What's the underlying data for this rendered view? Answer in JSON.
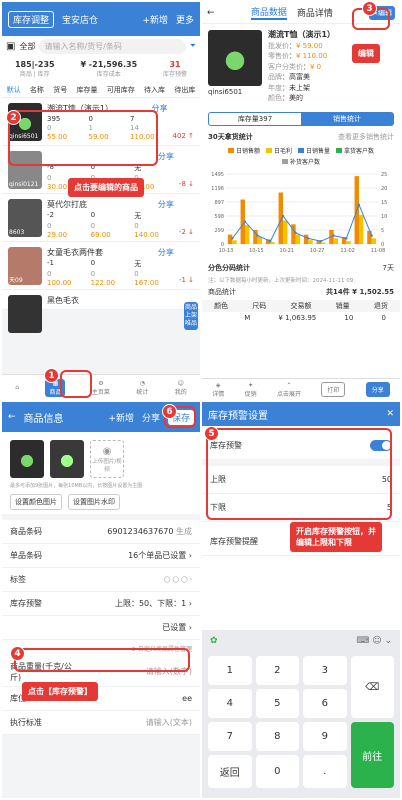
{
  "p1": {
    "header": {
      "title": "库存调整",
      "store": "宝安店仓",
      "new": "+新增",
      "more": "更多"
    },
    "search": {
      "scan": "扫一扫",
      "cat": "全部",
      "placeholder": "请输入名称/货号/条码",
      "filter": "筛选"
    },
    "stats": [
      {
        "v": "185|-235",
        "l": "商品 | 库存"
      },
      {
        "v": "¥ -21,596.35",
        "l": "库存成本"
      },
      {
        "v": "31",
        "l": "库存预警"
      }
    ],
    "cols": [
      "默认",
      "名称",
      "货号",
      "库存量",
      "可用库存",
      "待入库",
      "待出库"
    ],
    "items": [
      {
        "name": "潮流T恤（演示1）",
        "code": "qinsi6501",
        "n": [
          "395",
          "0",
          "7"
        ],
        "n2": [
          "0",
          "1",
          "14"
        ],
        "p": [
          "55.00",
          "59.00",
          "110.00"
        ],
        "trend": "402 ↑",
        "share": "分享"
      },
      {
        "name": "",
        "code": "qinsi0121",
        "n": [
          "-8",
          "0",
          "无"
        ],
        "n2": [
          "0",
          "0",
          "0"
        ],
        "p": [
          "30.00",
          "40.00",
          "69.00"
        ],
        "trend": "-8 ↓",
        "share": "分享"
      },
      {
        "name": "莫代尔打底",
        "code": "8603",
        "n": [
          "-2",
          "0",
          "无"
        ],
        "n2": [
          "0",
          "0",
          "0"
        ],
        "p": [
          "29.00",
          "69.00",
          "140.00"
        ],
        "trend": "-2 ↓",
        "share": "分享"
      },
      {
        "name": "女童毛衣两件套",
        "code": "天09",
        "n": [
          "-1",
          "0",
          "无"
        ],
        "n2": [
          "0",
          "0",
          "0"
        ],
        "p": [
          "100.00",
          "122.00",
          "167.00"
        ],
        "trend": "-1 ↓",
        "share": "分享"
      },
      {
        "name": "黑色毛衣",
        "code": "",
        "n": [],
        "n2": [],
        "p": [],
        "trend": "",
        "share": ""
      }
    ],
    "side": "商品",
    "side2": "上架",
    "side3": "唯品",
    "tabs": [
      "",
      "商品",
      "主页菜",
      "统计",
      "我的"
    ],
    "callout": "点击要编辑的商品"
  },
  "p2": {
    "tabs": [
      "商品数据",
      "商品详情"
    ],
    "edit": "编辑",
    "name": "潮流T恤（演示1）",
    "code": "qinsi6501",
    "info": [
      {
        "k": "批发价",
        "v": "¥ 59.00"
      },
      {
        "k": "零售价",
        "v": "¥ 110.00"
      },
      {
        "k": "客户分类价",
        "v": "¥ 0"
      },
      {
        "k": "品牌",
        "v": "高富美"
      },
      {
        "k": "年度",
        "v": "未上架"
      },
      {
        "k": "颜色",
        "v": "美的"
      }
    ],
    "stock_tab": "库存量397",
    "sales_tab": "销售统计",
    "chart_title": "30天拿货统计",
    "chart_more": "查看更多销售统计",
    "legend": [
      "日销售额",
      "日毛利",
      "日销售量",
      "拿货客户数",
      "补货客户数"
    ],
    "yleft": "金额",
    "yright": "数量",
    "sizes_title": "分色分码统计",
    "sizes_range": "7天",
    "sizes_note": "注：以下数据每小时更新，上次更新时间：2024-11-11 09:",
    "product_row": {
      "l": "商品统计",
      "r": "共14件  ¥ 1,502.55"
    },
    "thead": [
      "颜色",
      "尺码",
      "交易额",
      "销量",
      "退货"
    ],
    "trow": [
      "",
      "M",
      "¥ 1,063.95",
      "10",
      "0"
    ],
    "bottom": [
      "详情",
      "促销",
      "点击展开",
      "打印",
      "分享"
    ]
  },
  "p3": {
    "title": "商品信息",
    "new": "+新增",
    "share": "分享",
    "save": "保存",
    "upload": "上传图片/视频",
    "hint": "最多可添加9张图片，每张10MB以内，长按图片设置为主图",
    "btn1": "设置颜色图片",
    "btn2": "设置图片水印",
    "rows": [
      {
        "k": "商品条码",
        "v": "6901234637670",
        "x": "生成"
      },
      {
        "k": "单品条码",
        "v": "16个单品已设置"
      },
      {
        "k": "标签",
        "v": ""
      },
      {
        "k": "库存预警",
        "v": "上限：50、下限：1"
      },
      {
        "k": "",
        "v": "已设置"
      }
    ],
    "custom": "自定义商品属性管理",
    "weight": "商品重量(千克/公斤)",
    "weight_ph": "请输入(数字)",
    "loc": "库位",
    "loc_v": "ee",
    "exec": "执行标准",
    "exec_ph": "请输入(文本)",
    "callout": "点击【库存预警】"
  },
  "p4": {
    "title": "库存预警设置",
    "toggle_label": "库存预警",
    "up_label": "上限",
    "up_val": "50",
    "low_label": "下限",
    "low_val": "5",
    "remind": "库存预警提醒",
    "callout1": "开启库存预警按钮，并",
    "callout2": "编辑上限和下限",
    "keys": [
      [
        "1",
        "2",
        "3",
        "⌫"
      ],
      [
        "4",
        "5",
        "6",
        ""
      ],
      [
        "7",
        "8",
        "9",
        "前往"
      ],
      [
        "返回",
        "0",
        ".",
        ""
      ]
    ]
  },
  "badges": [
    "1",
    "2",
    "3",
    "4",
    "5",
    "6"
  ],
  "chart_data": {
    "type": "line",
    "title": "30天拿货统计",
    "x": [
      "10-13",
      "10-15",
      "10-21",
      "10-27",
      "11-02",
      "11-08"
    ],
    "yleft_ticks": [
      0,
      299,
      598,
      897,
      1196,
      1495
    ],
    "yright_ticks": [
      0,
      5,
      10,
      15,
      20,
      25
    ],
    "series": [
      {
        "name": "日销售额",
        "values": [
          200,
          950,
          300,
          100,
          1100,
          420,
          200,
          80,
          300,
          150,
          1450,
          280
        ]
      },
      {
        "name": "日毛利",
        "values": [
          80,
          400,
          150,
          40,
          500,
          200,
          80,
          30,
          120,
          60,
          620,
          120
        ]
      },
      {
        "name": "日销售量",
        "values": [
          2,
          8,
          3,
          1,
          10,
          4,
          2,
          1,
          3,
          2,
          14,
          3
        ]
      }
    ]
  }
}
